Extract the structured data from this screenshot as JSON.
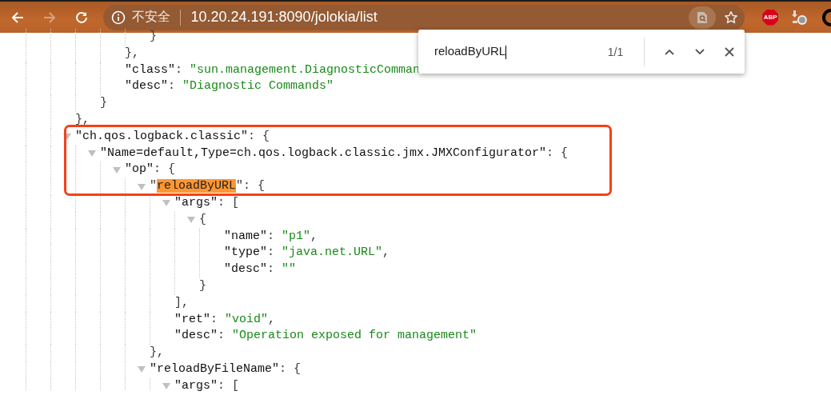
{
  "toolbar": {
    "nav": [
      {
        "kind": "back",
        "disabled": false
      },
      {
        "kind": "forward",
        "disabled": true
      },
      {
        "kind": "reload",
        "disabled": false
      }
    ],
    "omnibox": {
      "security": "不安全",
      "url": "10.20.24.191:8090/jolokia/list"
    },
    "extensions": {
      "abp": "ABP"
    }
  },
  "find_bar": {
    "query": "reloadByURL",
    "count": "1/1"
  },
  "tree": [
    {
      "children": [
        {
          "children": [
            {
              "children": [
                {
                  "children": [
                    {
                      "children": [
                        {
                          "tokens": [
                            {
                              "kind": "punct",
                              "text": "}"
                            }
                          ]
                        }
                      ]
                    },
                    {
                      "tokens": [
                        {
                          "kind": "punct",
                          "text": "},"
                        }
                      ]
                    },
                    {
                      "tokens": [
                        {
                          "kind": "key",
                          "text": "\"class\""
                        },
                        {
                          "kind": "punct",
                          "text": ": "
                        },
                        {
                          "kind": "string",
                          "text": "\"sun.management.DiagnosticComman"
                        }
                      ]
                    },
                    {
                      "tokens": [
                        {
                          "kind": "key",
                          "text": "\"desc\""
                        },
                        {
                          "kind": "punct",
                          "text": ": "
                        },
                        {
                          "kind": "string",
                          "text": "\"Diagnostic Commands\""
                        }
                      ]
                    }
                  ]
                },
                {
                  "tokens": [
                    {
                      "kind": "punct",
                      "text": "}"
                    }
                  ]
                }
              ]
            },
            {
              "tokens": [
                {
                  "kind": "punct",
                  "text": "},"
                }
              ]
            },
            {
              "expanded": true,
              "tokens": [
                {
                  "kind": "key",
                  "text": "\"ch.qos.logback.classic\""
                },
                {
                  "kind": "punct",
                  "text": ": {"
                }
              ],
              "children": [
                {
                  "expanded": true,
                  "tokens": [
                    {
                      "kind": "key",
                      "text": "\"Name=default,Type=ch.qos.logback.classic.jmx.JMXConfigurator\""
                    },
                    {
                      "kind": "punct",
                      "text": ": {"
                    }
                  ],
                  "children": [
                    {
                      "expanded": true,
                      "tokens": [
                        {
                          "kind": "key",
                          "text": "\"op\""
                        },
                        {
                          "kind": "punct",
                          "text": ": {"
                        }
                      ],
                      "children": [
                        {
                          "expanded": true,
                          "tokens": [
                            {
                              "kind": "punct",
                              "text": "\""
                            },
                            {
                              "kind": "match",
                              "text": "reloadByURL"
                            },
                            {
                              "kind": "punct",
                              "text": "\": {"
                            }
                          ],
                          "children": [
                            {
                              "expanded": true,
                              "tokens": [
                                {
                                  "kind": "key",
                                  "text": "\"args\""
                                },
                                {
                                  "kind": "punct",
                                  "text": ": ["
                                }
                              ],
                              "children": [
                                {
                                  "expanded": true,
                                  "tokens": [
                                    {
                                      "kind": "punct",
                                      "text": "{"
                                    }
                                  ],
                                  "children": [
                                    {
                                      "tokens": [
                                        {
                                          "kind": "key",
                                          "text": "\"name\""
                                        },
                                        {
                                          "kind": "punct",
                                          "text": ": "
                                        },
                                        {
                                          "kind": "string",
                                          "text": "\"p1\""
                                        },
                                        {
                                          "kind": "punct",
                                          "text": ","
                                        }
                                      ]
                                    },
                                    {
                                      "tokens": [
                                        {
                                          "kind": "key",
                                          "text": "\"type\""
                                        },
                                        {
                                          "kind": "punct",
                                          "text": ": "
                                        },
                                        {
                                          "kind": "string",
                                          "text": "\"java.net.URL\""
                                        },
                                        {
                                          "kind": "punct",
                                          "text": ","
                                        }
                                      ]
                                    },
                                    {
                                      "tokens": [
                                        {
                                          "kind": "key",
                                          "text": "\"desc\""
                                        },
                                        {
                                          "kind": "punct",
                                          "text": ": "
                                        },
                                        {
                                          "kind": "string",
                                          "text": "\"\""
                                        }
                                      ]
                                    }
                                  ]
                                },
                                {
                                  "tokens": [
                                    {
                                      "kind": "punct",
                                      "text": "}"
                                    }
                                  ]
                                }
                              ]
                            },
                            {
                              "tokens": [
                                {
                                  "kind": "punct",
                                  "text": "],"
                                }
                              ]
                            },
                            {
                              "tokens": [
                                {
                                  "kind": "key",
                                  "text": "\"ret\""
                                },
                                {
                                  "kind": "punct",
                                  "text": ": "
                                },
                                {
                                  "kind": "string",
                                  "text": "\"void\""
                                },
                                {
                                  "kind": "punct",
                                  "text": ","
                                }
                              ]
                            },
                            {
                              "tokens": [
                                {
                                  "kind": "key",
                                  "text": "\"desc\""
                                },
                                {
                                  "kind": "punct",
                                  "text": ": "
                                },
                                {
                                  "kind": "string",
                                  "text": "\"Operation exposed for management\""
                                }
                              ]
                            }
                          ]
                        },
                        {
                          "tokens": [
                            {
                              "kind": "punct",
                              "text": "},"
                            }
                          ]
                        },
                        {
                          "expanded": true,
                          "tokens": [
                            {
                              "kind": "key",
                              "text": "\"reloadByFileName\""
                            },
                            {
                              "kind": "punct",
                              "text": ": {"
                            }
                          ],
                          "children": [
                            {
                              "expanded": true,
                              "tokens": [
                                {
                                  "kind": "key",
                                  "text": "\"args\""
                                },
                                {
                                  "kind": "punct",
                                  "text": ": ["
                                }
                              ]
                            }
                          ]
                        }
                      ]
                    }
                  ]
                }
              ]
            }
          ]
        }
      ]
    }
  ]
}
